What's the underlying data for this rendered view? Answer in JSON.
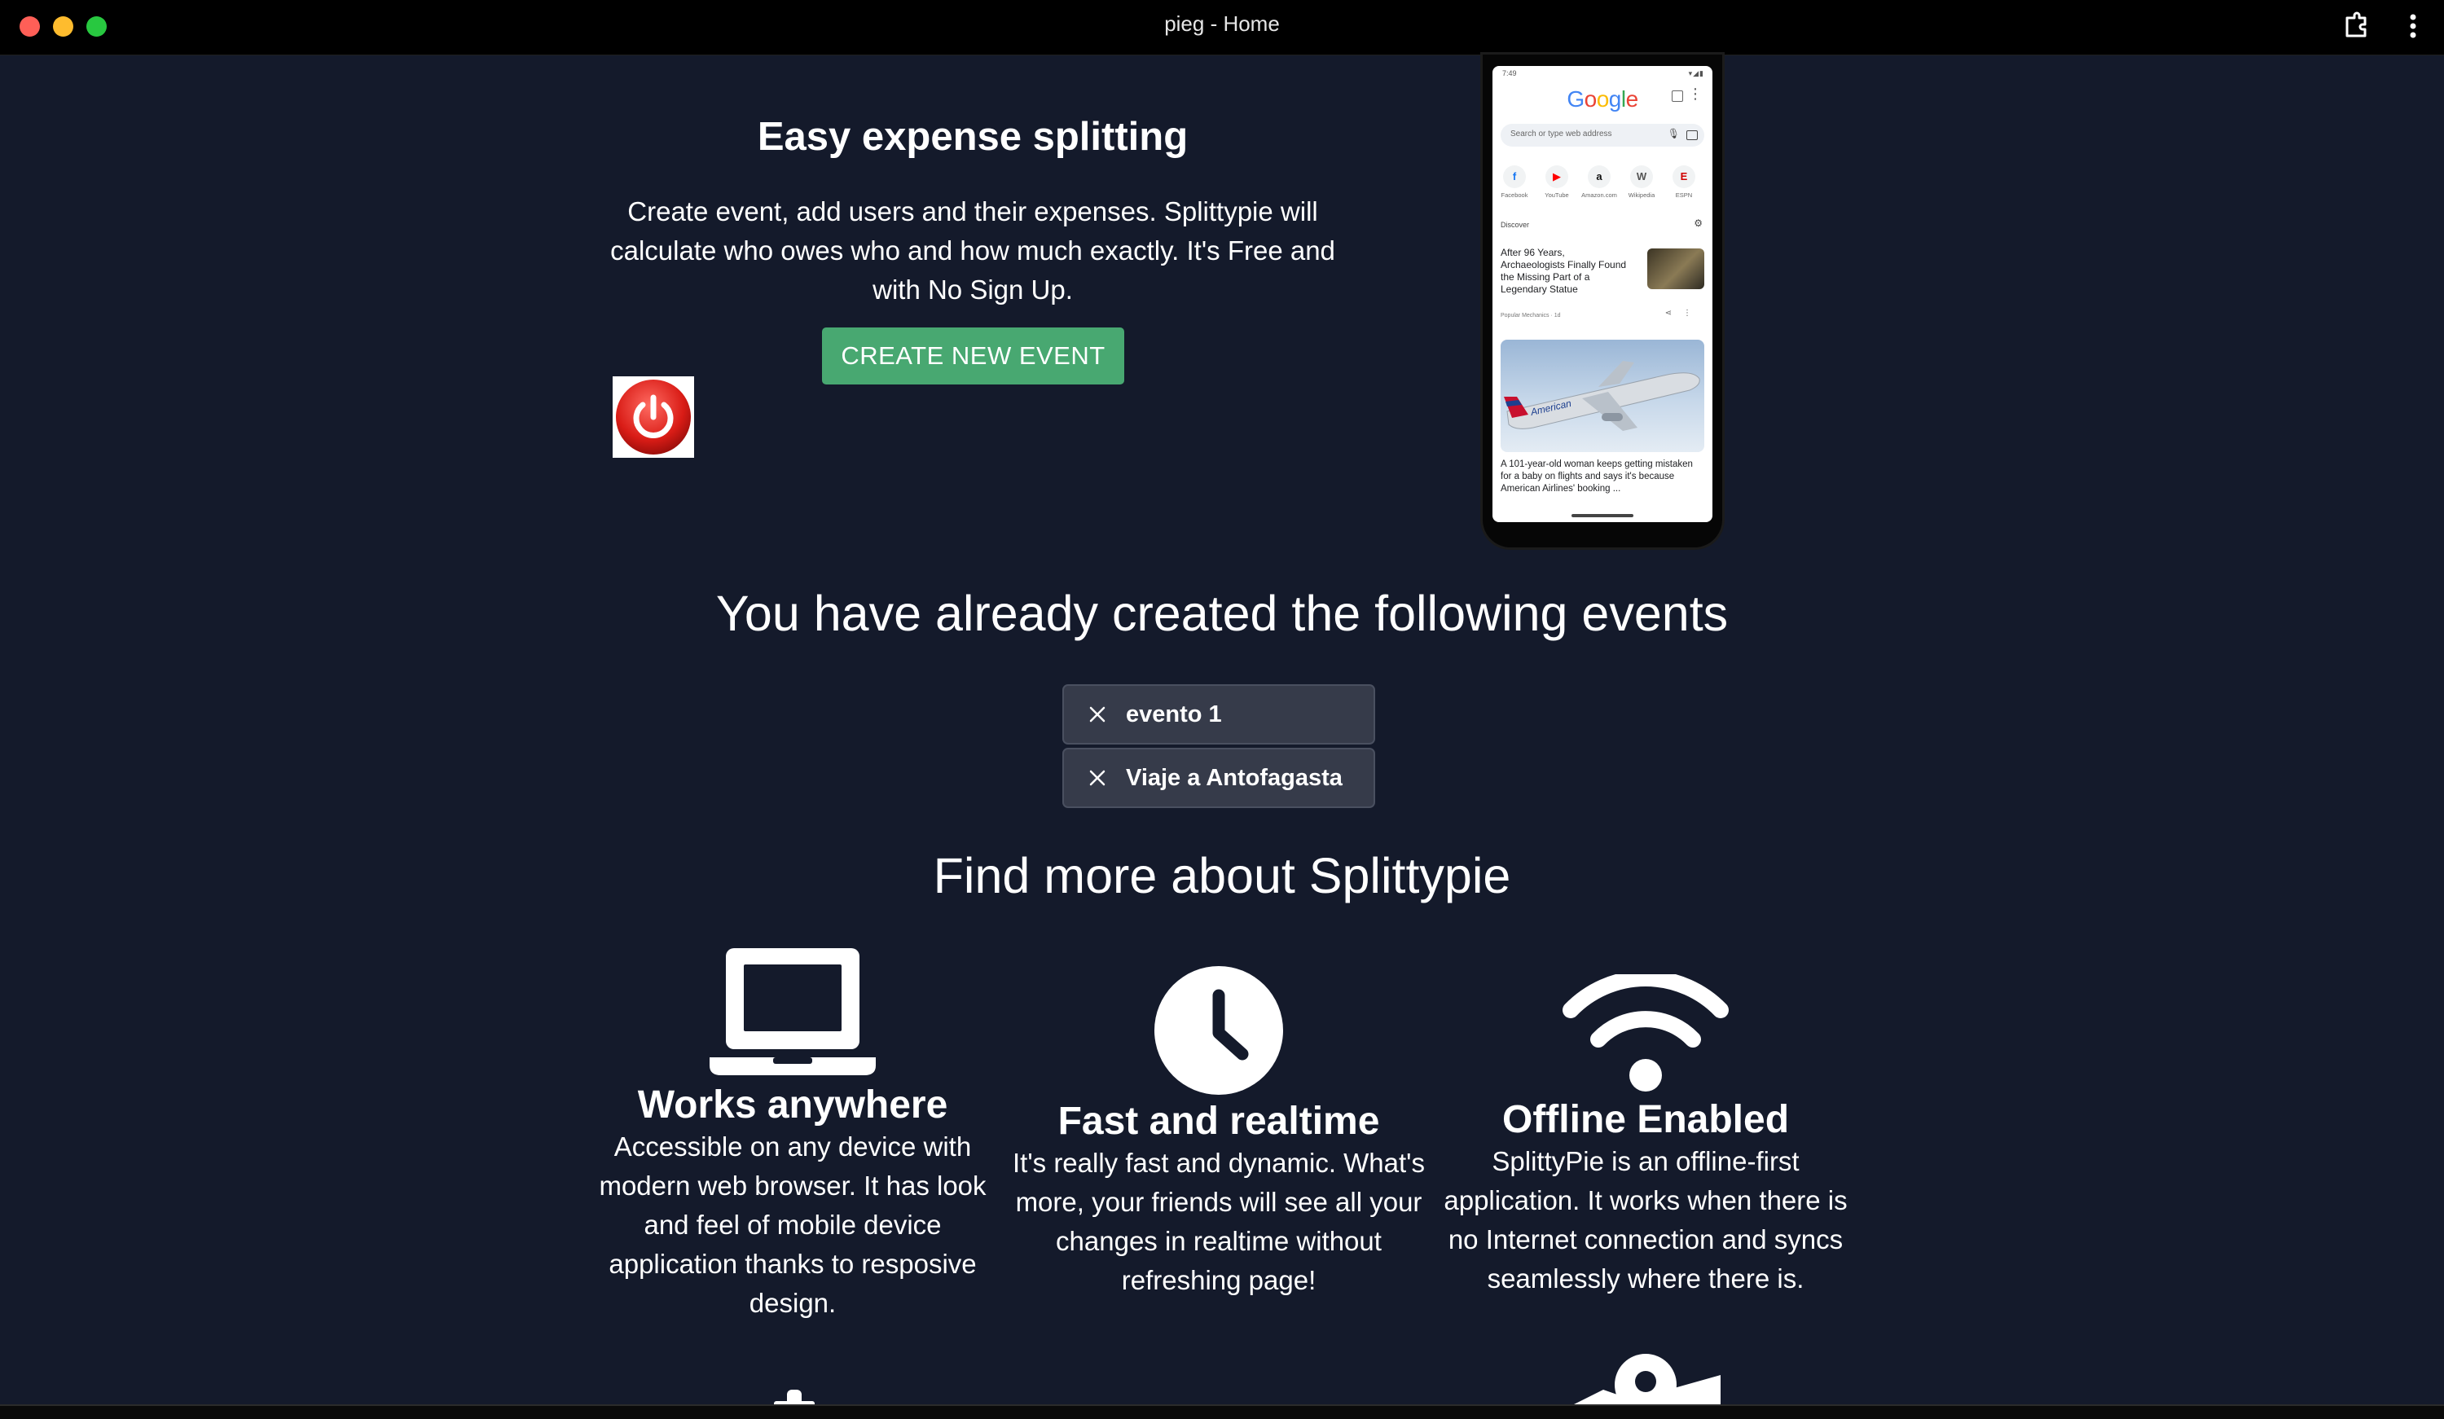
{
  "window": {
    "title": "pieg - Home",
    "traffic_colors": [
      "#ff5f57",
      "#febc2e",
      "#28c840"
    ]
  },
  "hero": {
    "title": "Easy expense splitting",
    "description": "Create event, add users and their expenses. Splittypie will calculate who owes who and how much exactly. It's Free and with No Sign Up.",
    "cta_label": "CREATE NEW EVENT",
    "cta_color": "#48a871",
    "power_icon": "power-button-icon"
  },
  "phone": {
    "time": "7:49",
    "status_right": "▾◢▮",
    "logo_letters": [
      {
        "ch": "G",
        "color": "#4285f4"
      },
      {
        "ch": "o",
        "color": "#ea4335"
      },
      {
        "ch": "o",
        "color": "#fbbc05"
      },
      {
        "ch": "g",
        "color": "#4285f4"
      },
      {
        "ch": "l",
        "color": "#34a853"
      },
      {
        "ch": "e",
        "color": "#ea4335"
      }
    ],
    "search_placeholder": "Search or type web address",
    "shortcuts": [
      {
        "label": "Facebook",
        "glyph": "f",
        "color": "#1877f2"
      },
      {
        "label": "YouTube",
        "glyph": "▶",
        "color": "#ff0000"
      },
      {
        "label": "Amazon.com",
        "glyph": "a",
        "color": "#111111"
      },
      {
        "label": "Wikipedia",
        "glyph": "W",
        "color": "#555555"
      },
      {
        "label": "ESPN",
        "glyph": "E",
        "color": "#d00000"
      }
    ],
    "discover_label": "Discover",
    "news_1": "After 96 Years, Archaeologists Finally Found the Missing Part of a Legendary Statue",
    "news_1_source": "Popular Mechanics · 1d",
    "news_2": "A 101-year-old woman keeps getting mistaken for a baby on flights and says it's because American Airlines' booking ...",
    "news_2_plane_text": "American"
  },
  "events": {
    "heading": "You have already created the following events",
    "items": [
      {
        "label": "evento 1"
      },
      {
        "label": "Viaje a Antofagasta"
      }
    ]
  },
  "about": {
    "heading": "Find more about Splittypie",
    "features": [
      {
        "title": "Works anywhere",
        "text": "Accessible on any device with modern web browser. It has look and feel of mobile device application thanks to resposive design.",
        "icon": "laptop-icon"
      },
      {
        "title": "Fast and realtime",
        "text": "It's really fast and dynamic. What's more, your friends will see all your changes in realtime without refreshing page!",
        "icon": "clock-icon"
      },
      {
        "title": "Offline Enabled",
        "text": "SplittyPie is an offline-first application. It works when there is no Internet connection and syncs seamlessly where there is.",
        "icon": "wifi-icon"
      }
    ]
  },
  "colors": {
    "background": "#141a2b",
    "event_item_bg": "#363b4a"
  }
}
